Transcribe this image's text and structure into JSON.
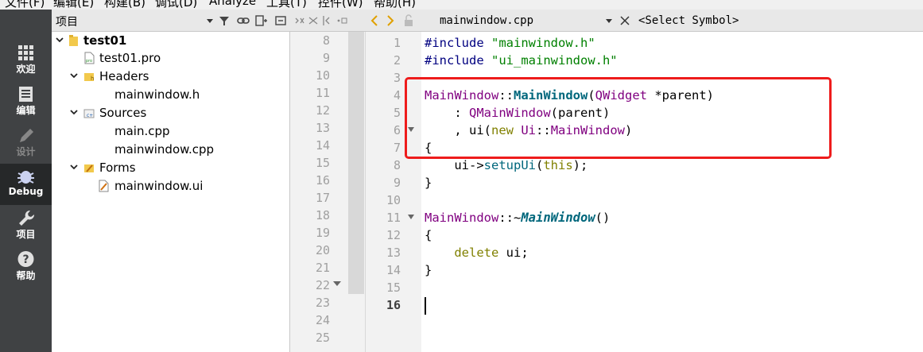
{
  "menu": [
    "文件(F)",
    "编辑(E)",
    "构建(B)",
    "调试(D)",
    "Analyze",
    "工具(T)",
    "控件(W)",
    "帮助(H)"
  ],
  "modes": [
    {
      "label": "欢迎",
      "icon": "grid-icon"
    },
    {
      "label": "编辑",
      "icon": "document-icon"
    },
    {
      "label": "设计",
      "icon": "pencil-icon"
    },
    {
      "label": "Debug",
      "icon": "bug-icon"
    },
    {
      "label": "项目",
      "icon": "wrench-icon"
    },
    {
      "label": "帮助",
      "icon": "help-icon"
    }
  ],
  "project_panel": {
    "title": "项目",
    "tree": [
      {
        "label": "test01",
        "depth": 0,
        "expanded": true,
        "bold": true,
        "icon": "project-icon"
      },
      {
        "label": "test01.pro",
        "depth": 1,
        "icon": "pro-file-icon"
      },
      {
        "label": "Headers",
        "depth": 1,
        "expanded": true,
        "icon": "headers-folder-icon"
      },
      {
        "label": "mainwindow.h",
        "depth": 2
      },
      {
        "label": "Sources",
        "depth": 1,
        "expanded": true,
        "icon": "sources-folder-icon"
      },
      {
        "label": "main.cpp",
        "depth": 2
      },
      {
        "label": "mainwindow.cpp",
        "depth": 2
      },
      {
        "label": "Forms",
        "depth": 1,
        "expanded": true,
        "icon": "forms-folder-icon"
      },
      {
        "label": "mainwindow.ui",
        "depth": 2,
        "icon": "ui-file-icon"
      }
    ]
  },
  "editor": {
    "file_name": "mainwindow.cpp",
    "symbol": "<Select Symbol>",
    "current_line": "16",
    "outline_line_numbers": [
      "8",
      "9",
      "10",
      "11",
      "12",
      "13",
      "14",
      "15",
      "16",
      "17",
      "18",
      "19",
      "20",
      "21",
      "22",
      "23",
      "24",
      "25"
    ],
    "line_numbers": [
      "1",
      "2",
      "3",
      "4",
      "5",
      "6",
      "7",
      "8",
      "9",
      "10",
      "11",
      "12",
      "13",
      "14",
      "15",
      "16"
    ]
  },
  "colors": {
    "mode_bar": "#404244",
    "highlight_box": "#ee1c1c",
    "class_name": "#800080",
    "function_name": "#00677c",
    "string": "#008000",
    "keyword": "#808000",
    "preprocessor": "#000080"
  }
}
